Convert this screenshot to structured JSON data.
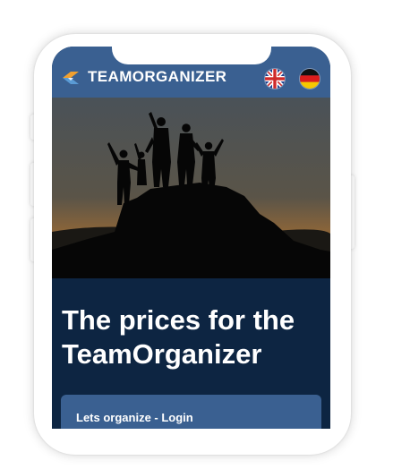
{
  "header": {
    "brand": "TEAMORGANIZER",
    "languages": [
      {
        "code": "en",
        "icon": "uk-flag-icon"
      },
      {
        "code": "de",
        "icon": "germany-flag-icon"
      }
    ]
  },
  "hero": {
    "icon": "team-summit-silhouette-image"
  },
  "main": {
    "title": "The prices for the TeamOrganizer",
    "cta_label": "Lets organize - Login"
  },
  "colors": {
    "header_bg": "#3a6091",
    "content_bg": "#0d2542",
    "button_bg": "#3a6091",
    "logo_orange": "#f0a030",
    "logo_blue": "#5a9bd5"
  }
}
